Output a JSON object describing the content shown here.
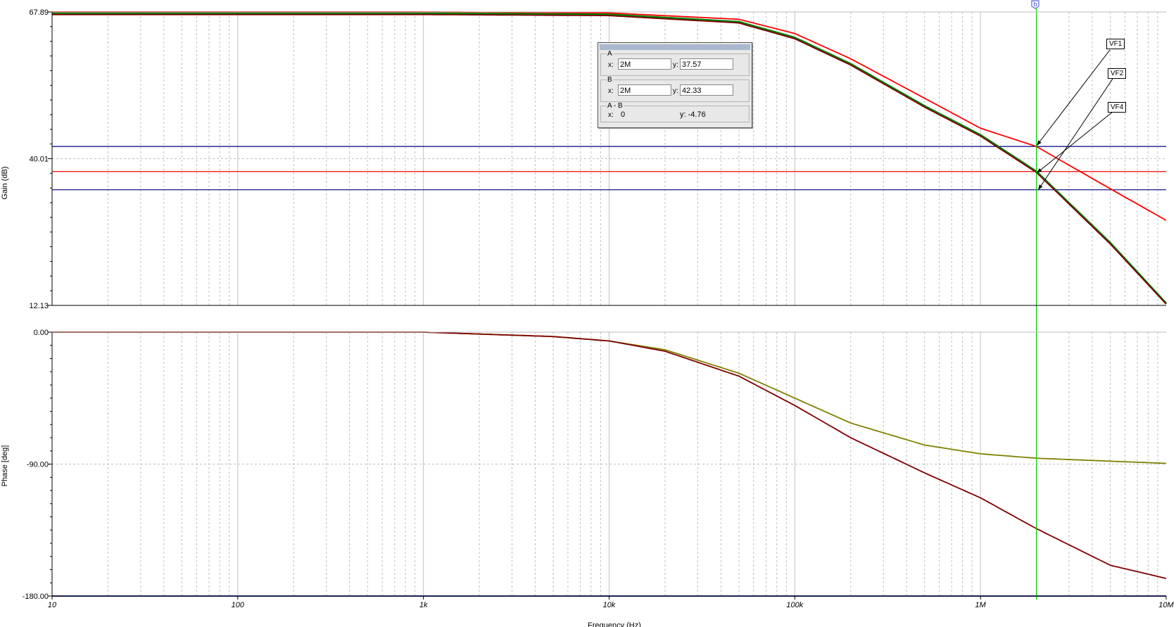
{
  "chart_data": [
    {
      "type": "line",
      "xlabel": "Frequency (Hz)",
      "ylabel": "Gain (dB)",
      "xscale": "log",
      "xlim": [
        10,
        10000000
      ],
      "ylim": [
        12.13,
        67.89
      ],
      "yticks": [
        "67.89",
        "40.01",
        "12.13"
      ],
      "xticks": [
        "10",
        "100",
        "1k",
        "10k",
        "100k",
        "1M",
        "10M"
      ],
      "grid": true,
      "series": [
        {
          "color": "#ff0000",
          "x": [
            10,
            1000,
            10000,
            50000,
            100000,
            200000,
            500000,
            1000000,
            2000000,
            5000000,
            10000000
          ],
          "y": [
            67.9,
            67.9,
            67.7,
            66.5,
            63.8,
            59.0,
            51.5,
            45.8,
            42.33,
            34.3,
            28.3
          ]
        },
        {
          "color": "#008000",
          "x": [
            10,
            1000,
            10000,
            50000,
            100000,
            200000,
            500000,
            1000000,
            2000000,
            5000000,
            10000000
          ],
          "y": [
            67.6,
            67.6,
            67.4,
            66.0,
            63.0,
            58.0,
            50.0,
            44.5,
            37.57,
            24.0,
            12.5
          ]
        },
        {
          "color": "#7f0000",
          "x": [
            10,
            1000,
            10000,
            50000,
            100000,
            200000,
            500000,
            1000000,
            2000000,
            5000000,
            10000000
          ],
          "y": [
            67.4,
            67.4,
            67.2,
            65.8,
            62.8,
            57.8,
            49.8,
            44.3,
            37.4,
            23.8,
            12.4
          ]
        }
      ],
      "hlines": [
        {
          "y": 42.33,
          "color": "#000080"
        },
        {
          "y": 37.57,
          "color": "#ff0000"
        },
        {
          "y": 34.1,
          "color": "#000080"
        }
      ]
    },
    {
      "type": "line",
      "xlabel": "Frequency (Hz)",
      "ylabel": "Phase [deg]",
      "xscale": "log",
      "xlim": [
        10,
        10000000
      ],
      "ylim": [
        -180,
        0
      ],
      "yticks": [
        "0.00",
        "-90.00",
        "-180.00"
      ],
      "grid": true,
      "series": [
        {
          "color": "#808000",
          "x": [
            10,
            1000,
            5000,
            10000,
            20000,
            50000,
            100000,
            200000,
            500000,
            1000000,
            2000000,
            5000000,
            10000000
          ],
          "y": [
            0,
            0,
            -3,
            -6,
            -12,
            -28,
            -45,
            -62,
            -77,
            -83,
            -86,
            -88,
            -89.5
          ]
        },
        {
          "color": "#7f0000",
          "x": [
            10,
            1000,
            5000,
            10000,
            20000,
            50000,
            100000,
            200000,
            500000,
            1000000,
            2000000,
            5000000,
            10000000
          ],
          "y": [
            0,
            0,
            -3,
            -6,
            -13,
            -30,
            -50,
            -72,
            -96,
            -113,
            -134,
            -159,
            -168
          ]
        },
        {
          "color": "#000080",
          "x": [
            10,
            10000000
          ],
          "y": [
            -180,
            -180
          ]
        }
      ]
    }
  ],
  "cursor": {
    "marker": "b",
    "a_label": "A",
    "a_x_label": "x:",
    "a_x": "2M",
    "a_y_label": "y:",
    "a_y": "37.57",
    "b_label": "B",
    "b_x_label": "x:",
    "b_x": "2M",
    "b_y_label": "y:",
    "b_y": "42.33",
    "diff_label": "A - B",
    "diff_x_label": "x:",
    "diff_x": "0",
    "diff_y": "y: -4.76",
    "freq": 2000000
  },
  "annotations": [
    "VF1",
    "VF2",
    "VF4"
  ],
  "colors": {
    "cursor_line": "#00cc00",
    "grid": "#c0c0c0"
  }
}
